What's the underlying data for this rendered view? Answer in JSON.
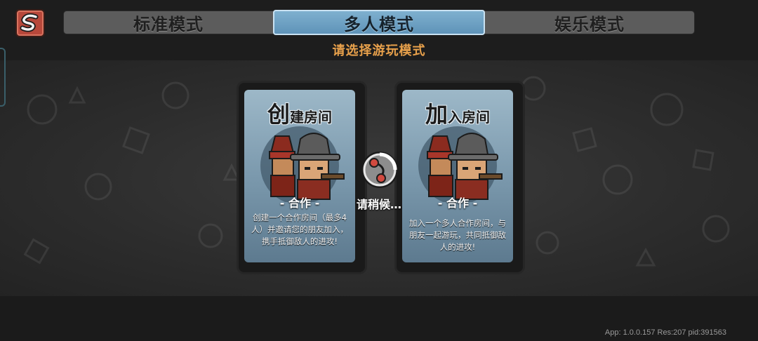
{
  "tabs": [
    {
      "label": "标准模式",
      "active": false
    },
    {
      "label": "多人模式",
      "active": true
    },
    {
      "label": "娱乐模式",
      "active": false
    }
  ],
  "subtitle": "请选择游玩模式",
  "cards": [
    {
      "title_big": "创",
      "title_rest": "建房间",
      "mode": "- 合作 -",
      "description": "创建一个合作房间（最多4人）并邀请您的朋友加入，携手抵御敌人的进攻!"
    },
    {
      "title_big": "加",
      "title_rest": "入房间",
      "mode": "- 合作 -",
      "description": "加入一个多人合作房间，与朋友一起游玩，共同抵御敌人的进攻!"
    }
  ],
  "loading": {
    "text": "请稍候…"
  },
  "version_info": "App: 1.0.0.157 Res:207 pid:391563",
  "colors": {
    "accent": "#e7a04b",
    "active_tab": "#6fa3c6",
    "card": "#7b99ad",
    "back_button": "#b7483b"
  },
  "icons": {
    "back": "s-back-icon",
    "spinner": "loading-spinner-icon"
  }
}
